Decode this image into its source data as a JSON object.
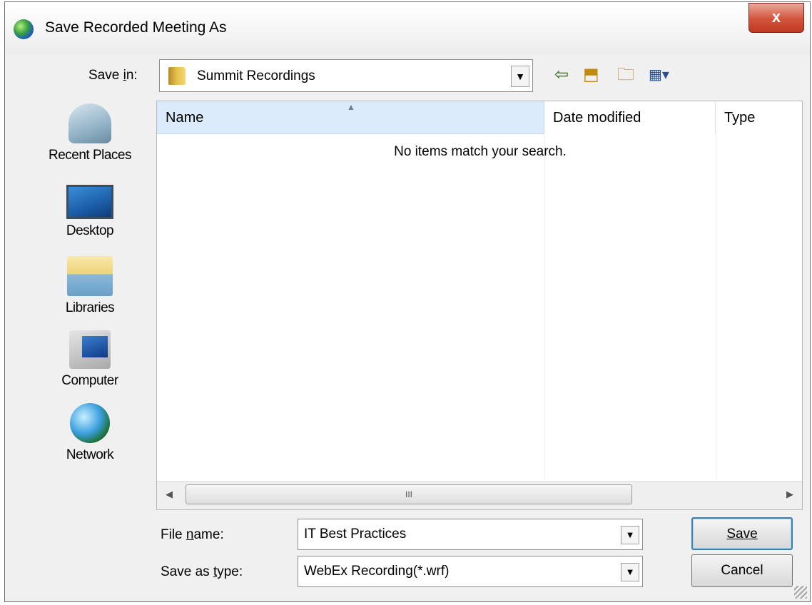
{
  "window": {
    "title": "Save Recorded Meeting As",
    "close_label": "x"
  },
  "save_in": {
    "label": "Save in:",
    "value": "Summit Recordings"
  },
  "toolbar": {
    "icons": [
      "back-arrow-icon",
      "up-one-level-icon",
      "new-folder-icon",
      "view-menu-icon"
    ]
  },
  "places": [
    {
      "label": "Recent Places",
      "icon": "recent-places-icon"
    },
    {
      "label": "Desktop",
      "icon": "desktop-icon"
    },
    {
      "label": "Libraries",
      "icon": "libraries-icon"
    },
    {
      "label": "Computer",
      "icon": "computer-icon"
    },
    {
      "label": "Network",
      "icon": "network-icon"
    }
  ],
  "file_list": {
    "columns": [
      "Name",
      "Date modified",
      "Type"
    ],
    "sorted_column": "Name",
    "empty_message": "No items match your search.",
    "scroll_thumb_label": "III"
  },
  "file_name": {
    "label": "File name:",
    "value": "IT Best Practices"
  },
  "save_as_type": {
    "label": "Save as type:",
    "value": "WebEx Recording(*.wrf)"
  },
  "buttons": {
    "save": "Save",
    "cancel": "Cancel"
  }
}
